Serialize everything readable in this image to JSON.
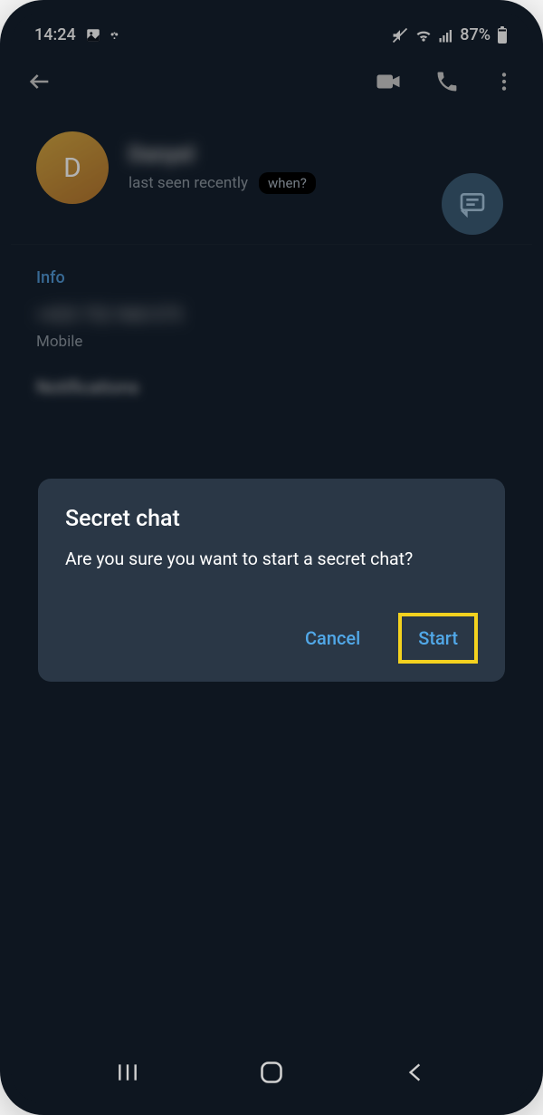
{
  "status": {
    "time": "14:24",
    "battery": "87%"
  },
  "profile": {
    "avatar_letter": "D",
    "name": "Danyel",
    "last_seen": "last seen recently",
    "when": "when?"
  },
  "info": {
    "header": "Info",
    "phone": "+420 752 968 075",
    "phone_label": "Mobile",
    "notifications": "Notifications"
  },
  "dialog": {
    "title": "Secret chat",
    "message": "Are you sure you want to start a secret chat?",
    "cancel": "Cancel",
    "start": "Start"
  }
}
